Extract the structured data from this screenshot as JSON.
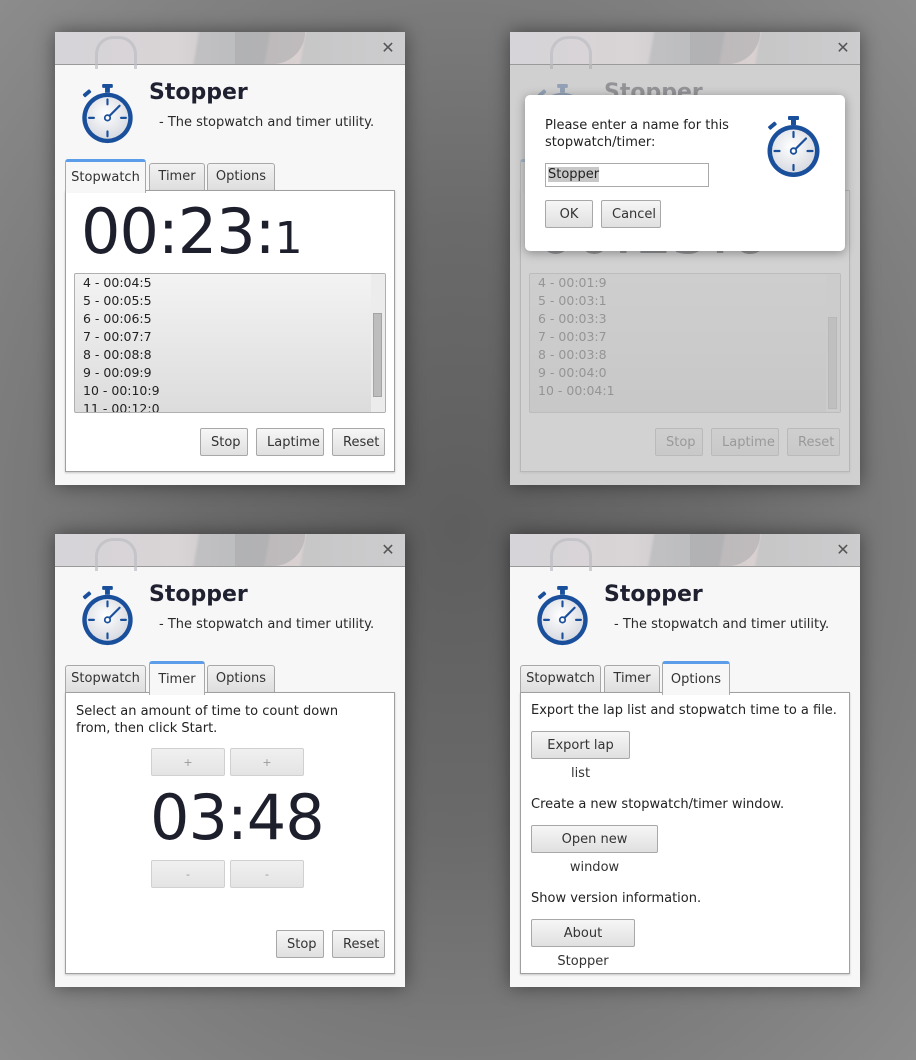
{
  "app": {
    "name": "Stopper",
    "subtitle": "- The stopwatch and timer utility.",
    "icon": "stopwatch-icon",
    "close_icon": "close-icon",
    "accent_color": "#5b9de8",
    "icon_color": "#1a4f9c"
  },
  "tabs": [
    "Stopwatch",
    "Timer",
    "Options"
  ],
  "window_stopwatch": {
    "active_tab": "Stopwatch",
    "time_main": "00:23:",
    "time_tenth": "1",
    "laps": [
      "4 - 00:04:5",
      "5 - 00:05:5",
      "6 - 00:06:5",
      "7 - 00:07:7",
      "8 - 00:08:8",
      "9 - 00:09:9",
      "10 - 00:10:9",
      "11 - 00:12:0"
    ],
    "buttons": {
      "stop": "Stop",
      "laptime": "Laptime",
      "reset": "Reset"
    }
  },
  "window_dialog": {
    "active_tab": "Stopwatch",
    "background_time": "00:15:6",
    "laps": [
      "4 - 00:01:9",
      "5 - 00:03:1",
      "6 - 00:03:3",
      "7 - 00:03:7",
      "8 - 00:03:8",
      "9 - 00:04:0",
      "10 - 00:04:1"
    ],
    "buttons": {
      "stop": "Stop",
      "laptime": "Laptime",
      "reset": "Reset"
    },
    "dialog": {
      "prompt": "Please enter a name for this stopwatch/timer:",
      "input_value": "Stopper",
      "ok": "OK",
      "cancel": "Cancel"
    }
  },
  "window_timer": {
    "active_tab": "Timer",
    "instructions": "Select an amount of time to count down from, then click Start.",
    "time": "03:48",
    "plus": "+",
    "minus": "-",
    "buttons": {
      "stop": "Stop",
      "reset": "Reset"
    }
  },
  "window_options": {
    "active_tab": "Options",
    "sections": [
      {
        "description": "Export the lap list and stopwatch time to a file.",
        "button": "Export lap list"
      },
      {
        "description": "Create a new stopwatch/timer window.",
        "button": "Open new window"
      },
      {
        "description": "Show version information.",
        "button": "About Stopper"
      }
    ]
  }
}
